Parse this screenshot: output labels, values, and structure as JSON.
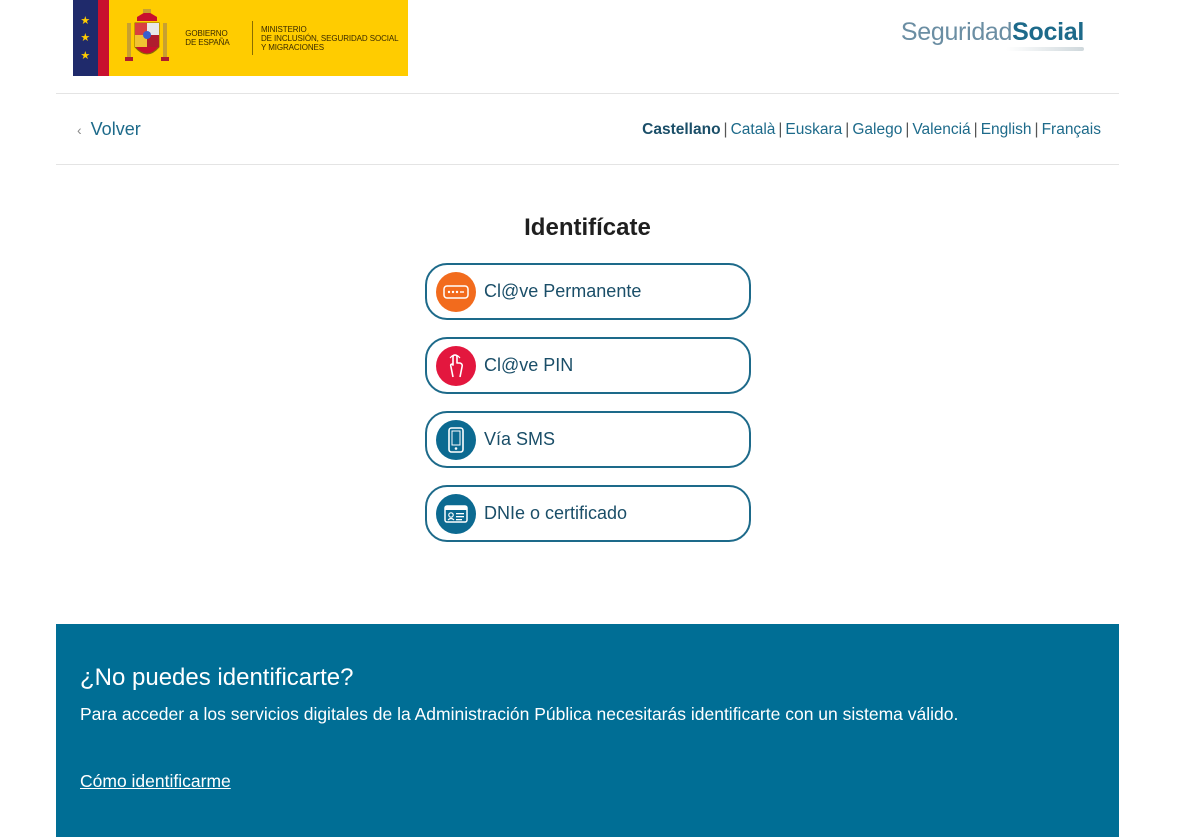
{
  "header": {
    "gov_line1": "GOBIERNO",
    "gov_line2": "DE ESPAÑA",
    "ministry_line1": "MINISTERIO",
    "ministry_line2": "DE INCLUSIÓN, SEGURIDAD SOCIAL",
    "ministry_line3": "Y MIGRACIONES",
    "logo_light": "Seguridad",
    "logo_bold": "Social"
  },
  "nav": {
    "back_label": "Volver",
    "languages": [
      {
        "label": "Castellano",
        "active": true
      },
      {
        "label": "Català",
        "active": false
      },
      {
        "label": "Euskara",
        "active": false
      },
      {
        "label": "Galego",
        "active": false
      },
      {
        "label": "Valenciá",
        "active": false
      },
      {
        "label": "English",
        "active": false
      },
      {
        "label": "Français",
        "active": false
      }
    ]
  },
  "main": {
    "title": "Identifícate",
    "options": [
      {
        "label": "Cl@ve Permanente",
        "icon": "password-field-icon",
        "color": "#f26b1d"
      },
      {
        "label": "Cl@ve PIN",
        "icon": "hand-tap-icon",
        "color": "#e3173e"
      },
      {
        "label": "Vía SMS",
        "icon": "mobile-phone-icon",
        "color": "#0c6a91"
      },
      {
        "label": "DNIe o certificado",
        "icon": "id-card-icon",
        "color": "#0c6a91"
      }
    ]
  },
  "help": {
    "title": "¿No puedes identificarte?",
    "text": "Para acceder a los servicios digitales de la Administración Pública necesitarás identificarte con un sistema válido.",
    "link": "Cómo identificarme"
  },
  "colors": {
    "primary": "#1d6a8a",
    "help_bg": "#006e95",
    "gov_yellow": "#ffcc00"
  }
}
